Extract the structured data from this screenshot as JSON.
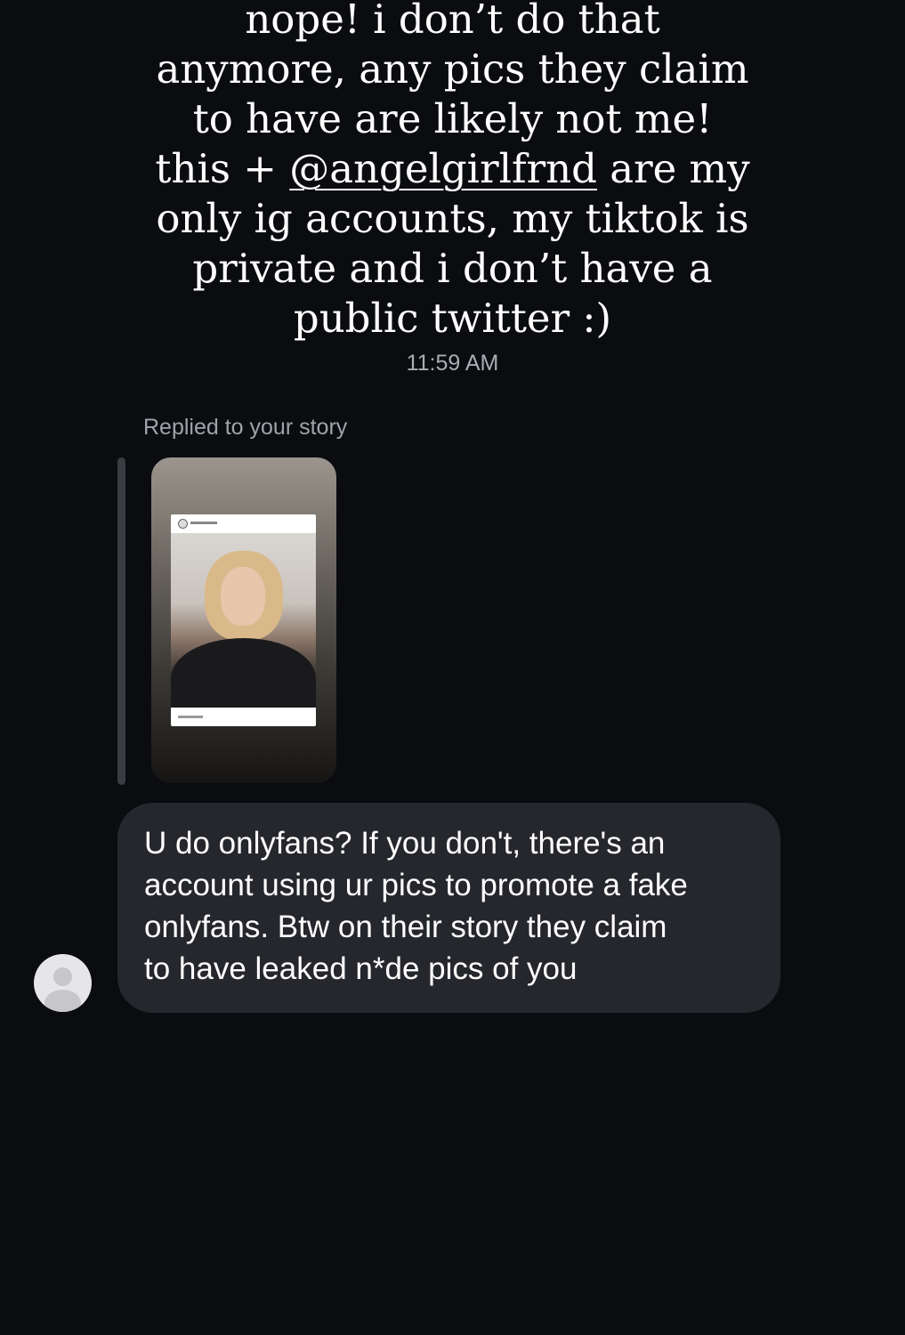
{
  "story_reply": {
    "lines": [
      "nope! i don’t do that",
      "anymore, any pics they claim",
      "to have are likely not me!",
      "this + ",
      "@angelgirlfrnd",
      " are my",
      "only ig accounts, my tiktok is",
      "private and i don’t have a",
      "public twitter :)"
    ],
    "time": "11:59 AM"
  },
  "story_context": {
    "label": "Replied to your story"
  },
  "message": {
    "lines": [
      "U do onlyfans? If you don't, there's an",
      "account using ur pics to promote a fake",
      "onlyfans. Btw on their story they claim",
      "to have leaked n*de pics of you"
    ]
  },
  "colors": {
    "background": "#0b0c10",
    "bubble": "#25272c",
    "secondary_text": "#a0a3aa"
  },
  "icons": {
    "sender_avatar": "default-profile-icon"
  }
}
